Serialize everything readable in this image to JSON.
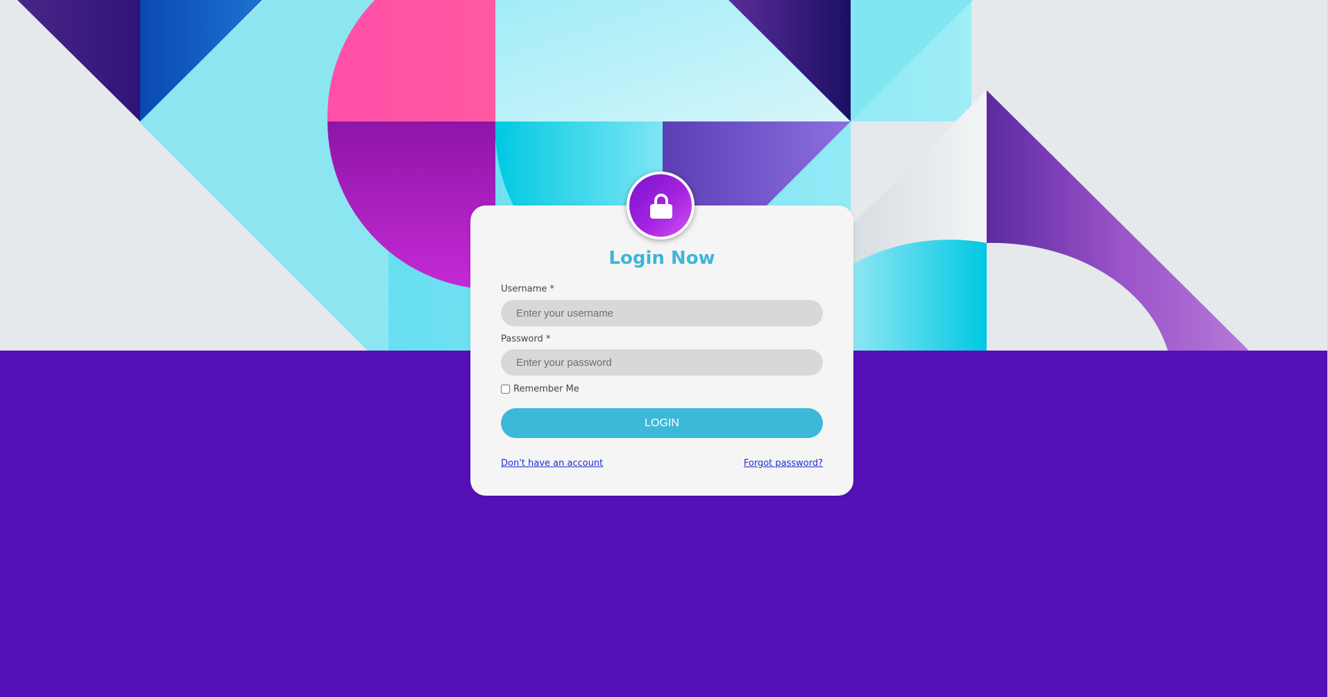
{
  "colors": {
    "page_background": "#5610b7",
    "card_background": "#f5f5f5",
    "accent": "#3cb8d9",
    "title": "#3fb5d8",
    "link": "#1f2bd6",
    "input_background": "#d8d8d8"
  },
  "avatar": {
    "icon": "lock-icon"
  },
  "login": {
    "title": "Login Now",
    "username_label": "Username *",
    "username_placeholder": "Enter your username",
    "username_value": "",
    "password_label": "Password *",
    "password_placeholder": "Enter your password",
    "password_value": "",
    "remember_label": "Remember Me",
    "remember_checked": false,
    "login_button": "LOGIN",
    "signup_link": "Don't have an account",
    "forgot_link": "Forgot password?"
  }
}
